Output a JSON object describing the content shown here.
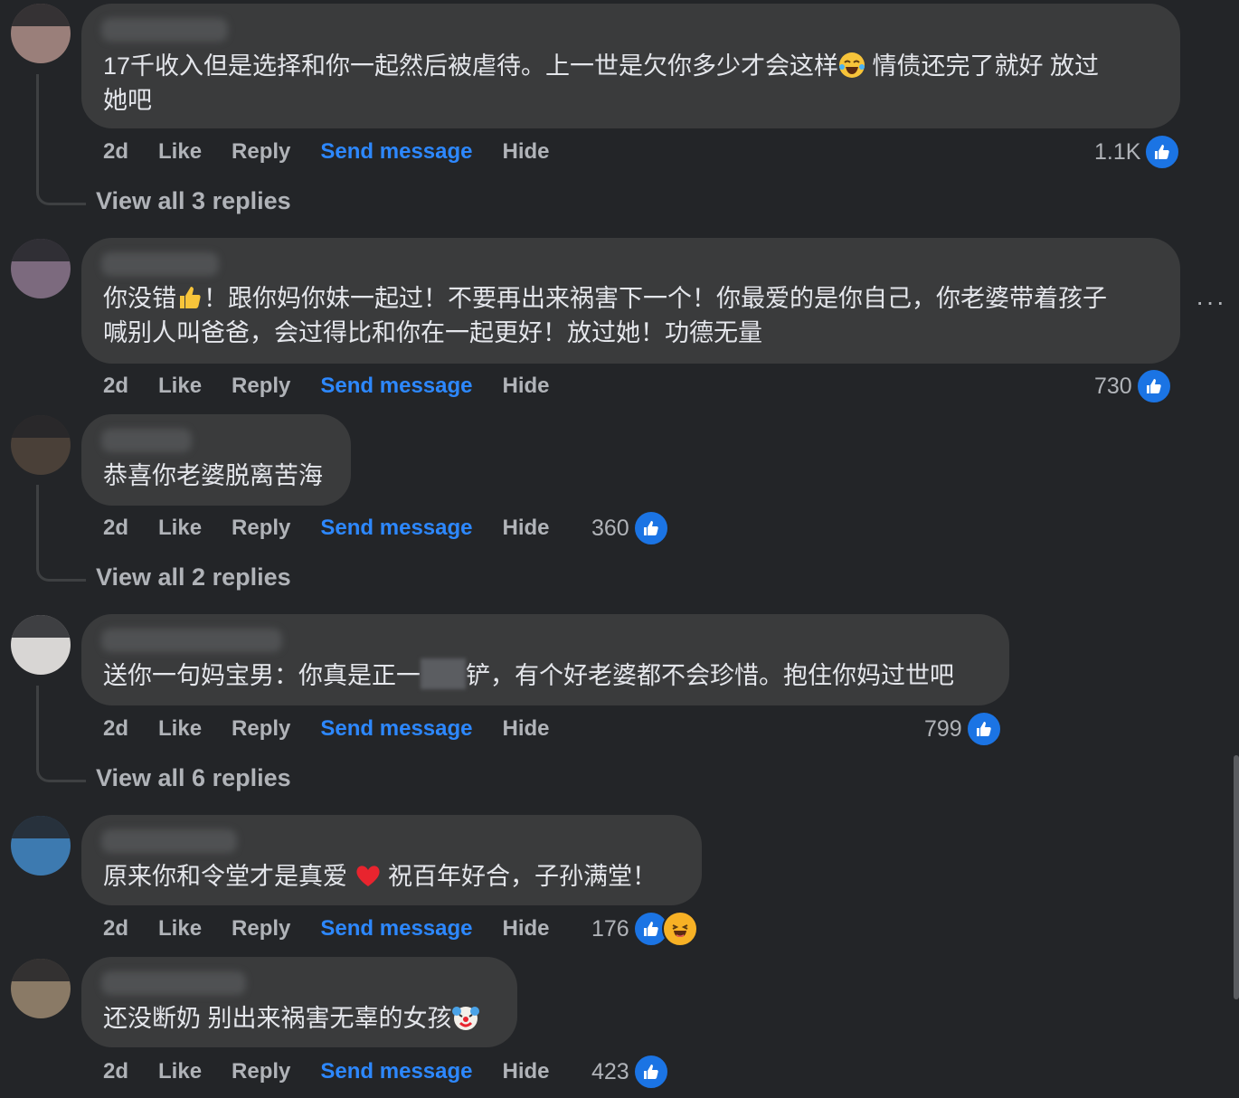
{
  "comments": [
    {
      "text_a": "17千收入但是选择和你一起然后被虐待。上一世是欠你多少才会这样",
      "text_b": " 情债还完了就好 放过",
      "text_c": "她吧",
      "time": "2d",
      "like": "Like",
      "reply": "Reply",
      "send": "Send message",
      "hide": "Hide",
      "reactions": "1.1K",
      "view_replies": "View all 3 replies",
      "avatar_color": "#9a7f7a"
    },
    {
      "text_a": "你没错",
      "text_b": "！跟你妈你妹一起过！不要再出来祸害下一个！你最爱的是你自己，你老婆带着孩子",
      "text_c": "喊别人叫爸爸，会过得比和你在一起更好！放过她！功德无量",
      "time": "2d",
      "like": "Like",
      "reply": "Reply",
      "send": "Send message",
      "hide": "Hide",
      "reactions": "730",
      "avatar_color": "#7c6a7e"
    },
    {
      "text_a": "恭喜你老婆脱离苦海",
      "time": "2d",
      "like": "Like",
      "reply": "Reply",
      "send": "Send message",
      "hide": "Hide",
      "reactions": "360",
      "view_replies": "View all 2 replies",
      "avatar_color": "#4a4038"
    },
    {
      "text_a": "送你一句妈宝男：你真是正一",
      "text_b": "铲，有个好老婆都不会珍惜。抱住你妈过世吧",
      "time": "2d",
      "like": "Like",
      "reply": "Reply",
      "send": "Send message",
      "hide": "Hide",
      "reactions": "799",
      "view_replies": "View all 6 replies",
      "avatar_color": "#d8d6d4"
    },
    {
      "text_a": "原来你和令堂才是真爱 ",
      "text_b": " 祝百年好合，子孙满堂！",
      "time": "2d",
      "like": "Like",
      "reply": "Reply",
      "send": "Send message",
      "hide": "Hide",
      "reactions": "176",
      "avatar_color": "#3d7ab0"
    },
    {
      "text_a": "还没断奶 别出来祸害无辜的女孩",
      "time": "2d",
      "like": "Like",
      "reply": "Reply",
      "send": "Send message",
      "hide": "Hide",
      "reactions": "423",
      "avatar_color": "#8a7a66"
    }
  ],
  "icons": {
    "like": "thumbs-up-icon",
    "haha": "haha-emoji-icon",
    "more": "more-options-icon"
  },
  "colors": {
    "background": "#232528",
    "bubble": "#3a3b3c",
    "link": "#2d88ff",
    "like_blue": "#1b74e4"
  },
  "more_options": "···"
}
